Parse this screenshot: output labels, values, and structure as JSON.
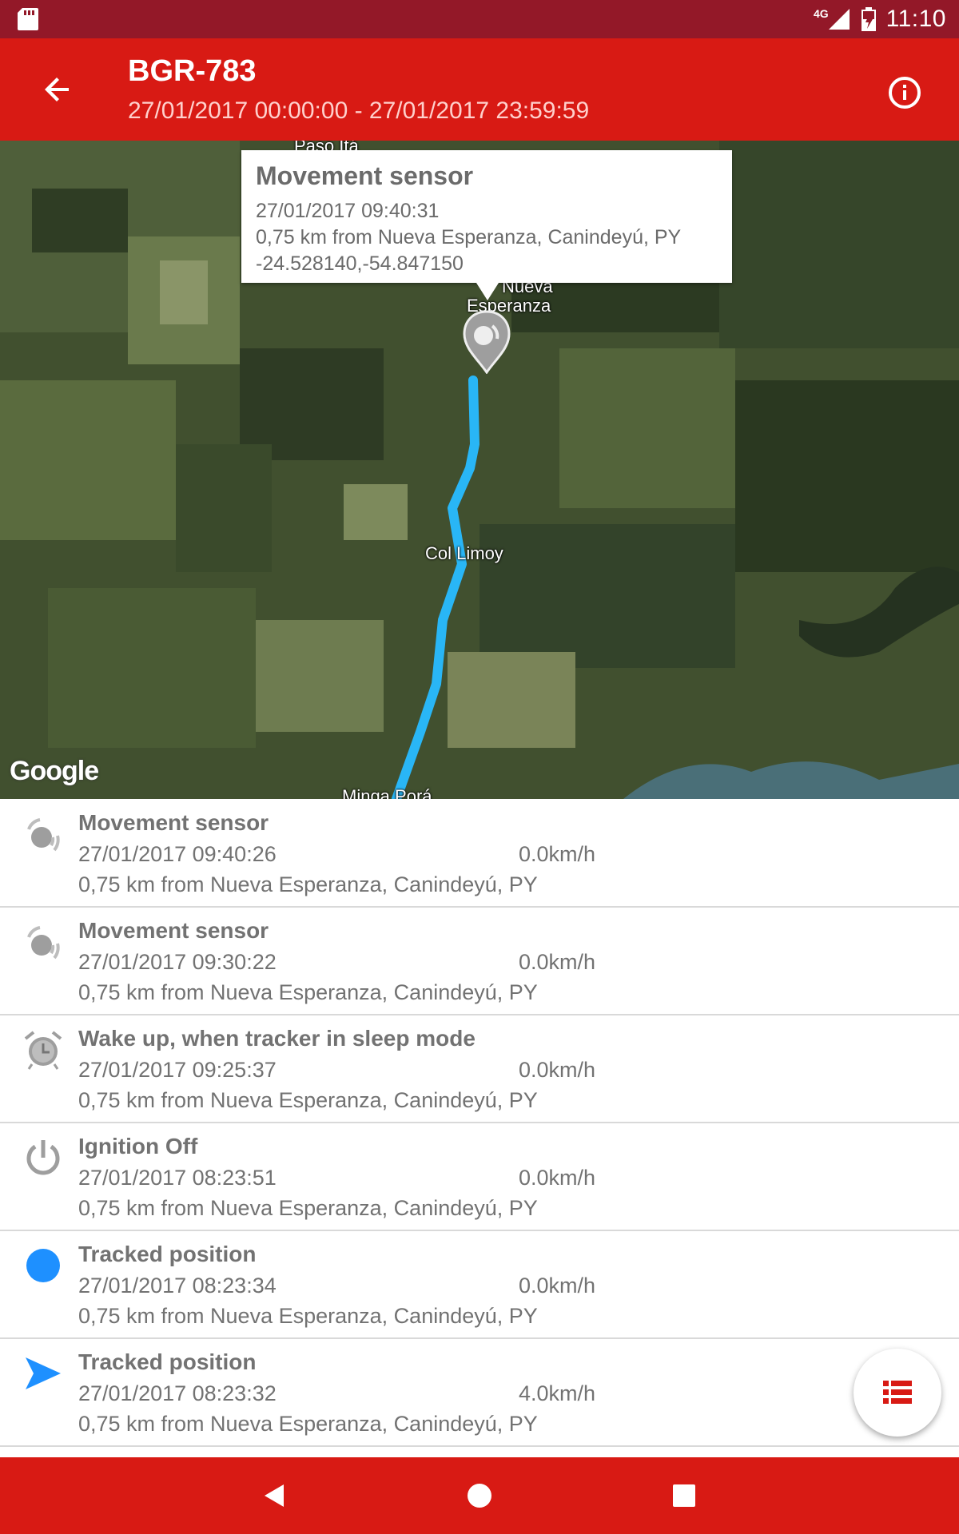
{
  "status_bar": {
    "network": "4G",
    "time": "11:10"
  },
  "app_bar": {
    "title": "BGR-783",
    "subtitle": "27/01/2017 00:00:00 - 27/01/2017 23:59:59",
    "back_icon": "arrow-back-icon",
    "info_icon": "info-icon"
  },
  "map": {
    "labels": {
      "paso_ita": "Paso Itá",
      "nueva": "Nueva",
      "esperanza": "Esperanza",
      "col_limoy": "Col Limoy",
      "minga_pora": "Minga Porá"
    },
    "attribution": "Google",
    "route_color": "#29b6f6",
    "info_window": {
      "title": "Movement sensor",
      "datetime": "27/01/2017 09:40:31",
      "address": "0,75 km from Nueva Esperanza, Canindeyú, PY",
      "coordinates": "-24.528140,-54.847150"
    }
  },
  "events": [
    {
      "icon": "movement-sensor-icon",
      "title": "Movement sensor",
      "datetime": "27/01/2017 09:40:26",
      "speed": "0.0km/h",
      "address": "0,75 km from Nueva Esperanza, Canindeyú, PY"
    },
    {
      "icon": "movement-sensor-icon",
      "title": "Movement sensor",
      "datetime": "27/01/2017 09:30:22",
      "speed": "0.0km/h",
      "address": "0,75 km from Nueva Esperanza, Canindeyú, PY"
    },
    {
      "icon": "alarm-clock-icon",
      "title": "Wake up, when tracker in sleep mode",
      "datetime": "27/01/2017 09:25:37",
      "speed": "0.0km/h",
      "address": "0,75 km from Nueva Esperanza, Canindeyú, PY"
    },
    {
      "icon": "power-icon",
      "title": "Ignition Off",
      "datetime": "27/01/2017 08:23:51",
      "speed": "0.0km/h",
      "address": "0,75 km from Nueva Esperanza, Canindeyú, PY"
    },
    {
      "icon": "tracked-dot-icon",
      "title": "Tracked position",
      "datetime": "27/01/2017 08:23:34",
      "speed": "0.0km/h",
      "address": "0,75 km from Nueva Esperanza, Canindeyú, PY"
    },
    {
      "icon": "direction-arrow-icon",
      "title": "Tracked position",
      "datetime": "27/01/2017 08:23:32",
      "speed": "4.0km/h",
      "address": "0,75 km from Nueva Esperanza, Canindeyú, PY"
    }
  ],
  "fab": {
    "icon": "list-icon"
  },
  "colors": {
    "primary": "#d81a14",
    "status_bar": "#931828",
    "accent_blue": "#1e90ff",
    "text_gray": "#727272"
  }
}
